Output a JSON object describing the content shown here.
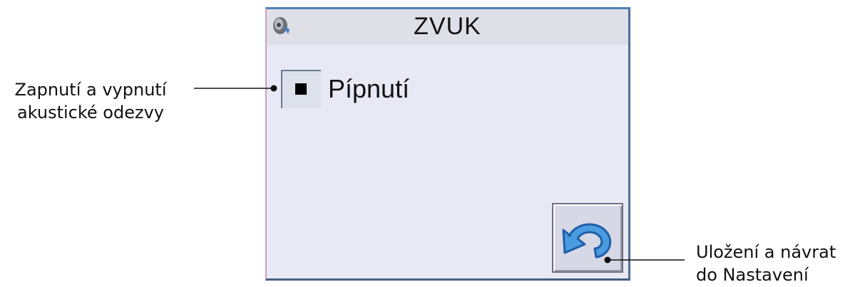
{
  "screen": {
    "title": "ZVUK",
    "title_icon": "speaker-icon",
    "option": {
      "label": "Pípnutí",
      "checked": true
    },
    "back_button": {
      "icon": "undo-arrow-icon"
    }
  },
  "annotations": {
    "beep_toggle": [
      "Zapnutí a vypnutí",
      "akustické odezvy"
    ],
    "save_return": [
      "Uložení a návrat",
      "do Nastavení"
    ]
  },
  "colors": {
    "screen_bg": "#e9e9f6",
    "titlebar_bg": "#dfdfe8",
    "icon_blue": "#2f7fd1"
  }
}
